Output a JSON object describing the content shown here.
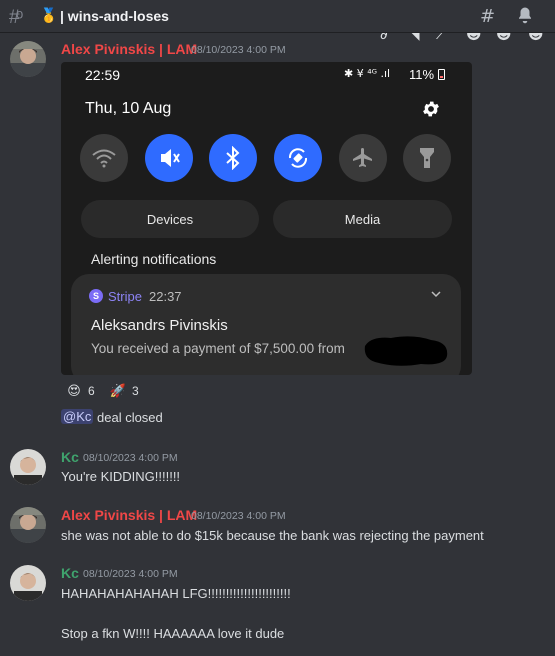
{
  "channel": {
    "hash_icon": "hash-icon",
    "emoji_icon": "medal-icon",
    "title": "| wins-and-loses",
    "thread_icon": "threads-icon",
    "bell_icon": "bell-icon"
  },
  "messages": [
    {
      "author": "Alex Pivinskis | LAM",
      "timestamp": "08/10/2023 4:00 PM",
      "attachment": {
        "status_time": "22:59",
        "status_icons": "✱ ¥ ⁴ᴳ .ıl",
        "battery": "11%",
        "date": "Thu, 10 Aug",
        "tiles": [
          "wifi",
          "mute",
          "bluetooth",
          "auto-rotate",
          "airplane",
          "flashlight"
        ],
        "devices_label": "Devices",
        "media_label": "Media",
        "section_label": "Alerting notifications",
        "notification": {
          "app": "Stripe",
          "app_initial": "S",
          "time": "22:37",
          "title": "Aleksandrs Pivinskis",
          "body": "You received a payment of $7,500.00 from"
        }
      },
      "reactions": [
        {
          "emoji": "heart-eyes",
          "count": "6"
        },
        {
          "emoji": "rocket",
          "count": "3"
        }
      ],
      "follow_up": {
        "mention": "@Kc",
        "text": "deal closed"
      }
    },
    {
      "author": "Kc",
      "timestamp": "08/10/2023 4:00 PM",
      "lines": [
        "You're KIDDING!!!!!!!"
      ]
    },
    {
      "author": "Alex Pivinskis | LAM",
      "timestamp": "08/10/2023 4:00 PM",
      "lines": [
        "she was not able to do $15k because the bank was rejecting the payment"
      ]
    },
    {
      "author": "Kc",
      "timestamp": "08/10/2023 4:00 PM",
      "lines": [
        "HAHAHAHAHAHAH LFG!!!!!!!!!!!!!!!!!!!!!!!",
        "Stop a fkn W!!!! HAAAAAA love it dude"
      ]
    }
  ],
  "colors": {
    "background": "#313338",
    "alex_name": "#f04747",
    "kc_name": "#3fa36d",
    "quick_setting_active": "#2f6bff",
    "mention_bg": "#3c4270"
  }
}
